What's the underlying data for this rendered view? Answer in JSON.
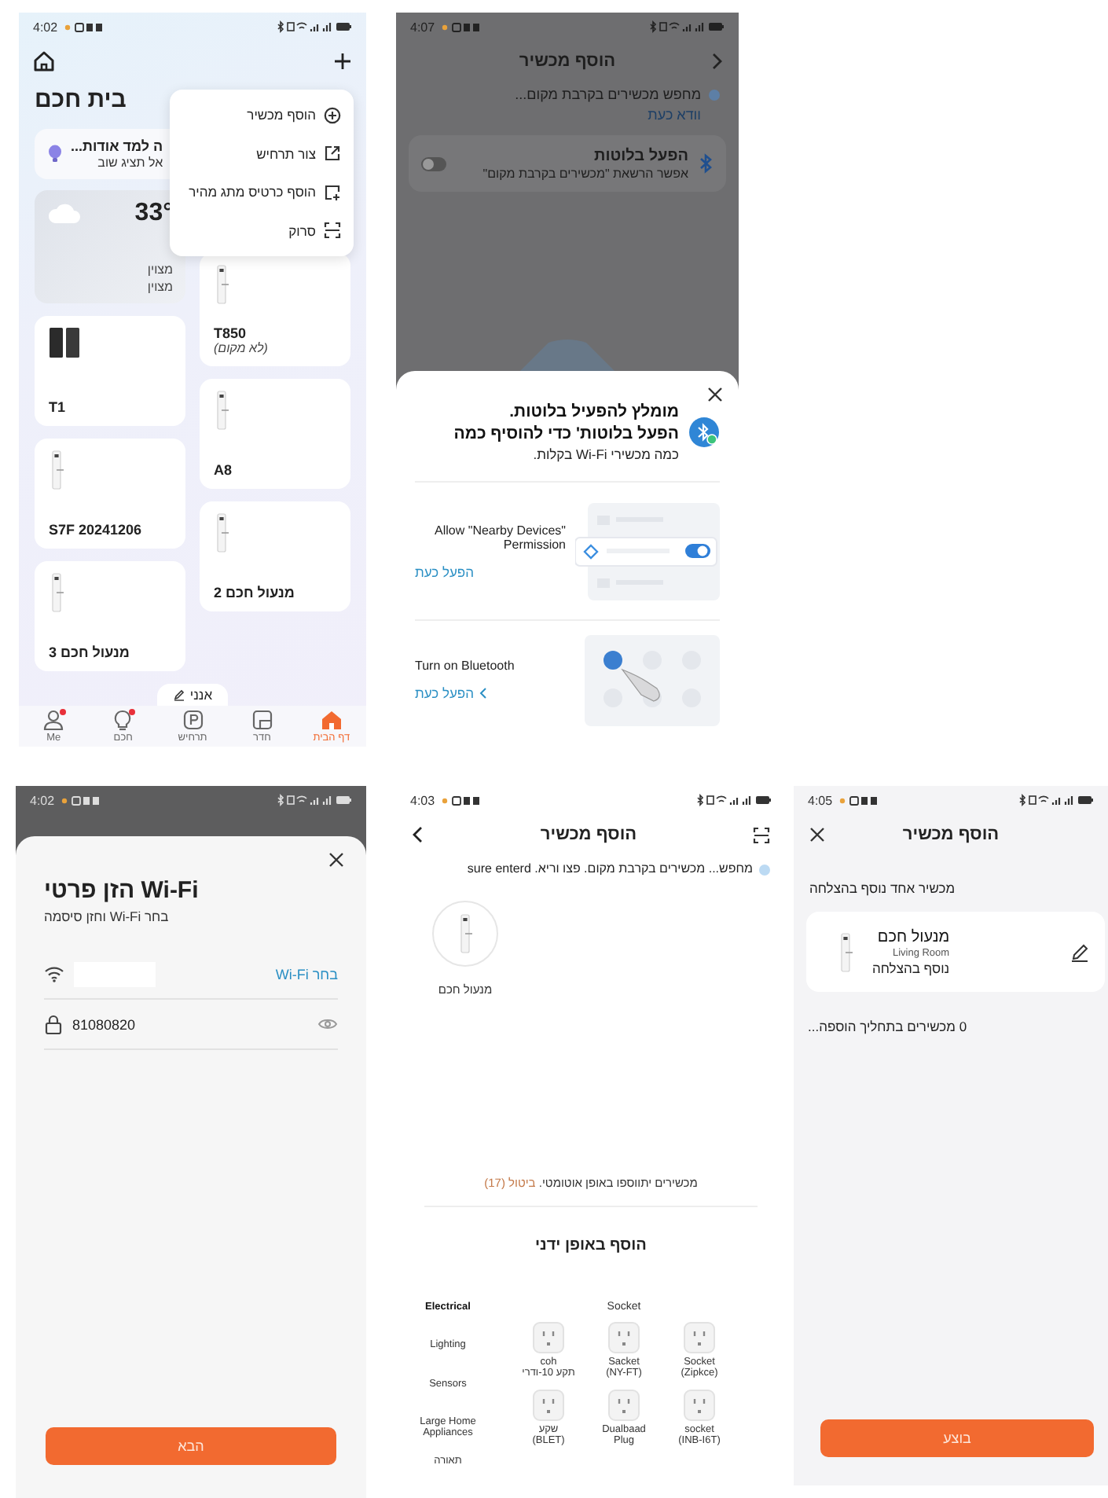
{
  "home_screen": {
    "status_time": "4:02",
    "title": "בית חכם",
    "tip": {
      "title": "ה למד אודות...",
      "subtitle": "אל תציג שוב"
    },
    "menu": [
      {
        "label": "הוסף מכשיר"
      },
      {
        "label": "צור תרחיש"
      },
      {
        "label": "הוסף כרטיס מתג מהיר"
      },
      {
        "label": "סרוק"
      }
    ],
    "columns": [
      {
        "cards": [
          {
            "kind": "weather",
            "temperature": "33°",
            "lines": [
              "מצוין",
              "מצוין"
            ]
          },
          {
            "kind": "keypad",
            "name": "T1"
          },
          {
            "kind": "lock",
            "name": "S7F 20241206"
          },
          {
            "kind": "lock",
            "name": "מנעול חכם 3"
          }
        ]
      },
      {
        "cards": [
          {
            "kind": "lock",
            "name": "T850",
            "note": "(לא מקום)"
          },
          {
            "kind": "lock",
            "name": "A8"
          },
          {
            "kind": "lock",
            "name": "מנעול חכם 2"
          }
        ]
      }
    ],
    "room_chip": "אנני",
    "nav": [
      {
        "label": "דף הבית",
        "badge": false,
        "selected": true
      },
      {
        "label": "חדר",
        "badge": false,
        "selected": false
      },
      {
        "label": "תרחיש",
        "badge": false,
        "selected": false
      },
      {
        "label": "חכם",
        "badge": true,
        "selected": false
      },
      {
        "label": "Me",
        "badge": true,
        "selected": false
      }
    ]
  },
  "bluetooth_screen": {
    "status_time": "4:07",
    "title": "הוסף מכשיר",
    "searching": "מחפש מכשירים בקרבת מקום...",
    "check_link": "וודא כעת",
    "bluetooth_card": {
      "title": "הפעל בלוטות",
      "subtitle": "אפשר הרשאת \"מכשירים בקרבת מקום\"",
      "on": false
    },
    "sheet": {
      "title_lines": [
        "מומלץ להפעיל בלוטות.",
        "הפעל בלוטות' כדי להוסיף כמה"
      ],
      "body": "כמה מכשירי Wi-Fi בקלות.",
      "steps": [
        {
          "kind": "permission",
          "text": "Allow \"Nearby Devices\" Permission",
          "link": "הפעל כעת"
        },
        {
          "kind": "bluetooth",
          "text": "Turn on Bluetooth",
          "link": "הפעל כעת"
        }
      ]
    }
  },
  "wifi_screen": {
    "status_time": "4:02",
    "title": "הזן פרטי Wi-Fi",
    "subtitle": "בחר Wi-Fi וחזן סיסמה",
    "choose_link": "בחר Wi-Fi",
    "password": "81080820",
    "next_button": "הבא"
  },
  "scan_screen": {
    "status_time": "4:03",
    "title": "הוסף מכשיר",
    "searching": "מחפש... מכשירים בקרבת מקום. פצו וריא. sure enterd",
    "found": [
      {
        "name": "מנעול חכם"
      }
    ],
    "auto_add": "מכשירים יתווספו באופן אוטומטי.",
    "cancel": "ביטול (17)",
    "manual_title": "הוסף באופן ידני",
    "categories": [
      {
        "label": "Electrical",
        "selected": true
      },
      {
        "label": "Lighting",
        "selected": false
      },
      {
        "label": "Sensors",
        "selected": false
      },
      {
        "label": "Large Home Appliances",
        "selected": false
      },
      {
        "label": "תאורה",
        "selected": false
      }
    ],
    "group_title": "Socket",
    "products": [
      {
        "lines": [
          "Socket",
          "(Zipkce)"
        ]
      },
      {
        "lines": [
          "Sacket",
          "(NY-FT)"
        ]
      },
      {
        "lines": [
          "coh",
          "תקע 10-ודרי"
        ]
      },
      {
        "lines": [
          "socket",
          "(INB-I6T)"
        ]
      },
      {
        "lines": [
          "Dualbaad",
          "Plug"
        ]
      },
      {
        "lines": [
          "שקע",
          "(BLET)"
        ]
      }
    ]
  },
  "done_screen": {
    "status_time": "4:05",
    "title": "הוסף מכשיר",
    "success_note": "מכשיר אחד נוסף בהצלחה",
    "device": {
      "name": "מנעול חכם",
      "room": "Living Room",
      "status": "נוסף בהצלחה"
    },
    "pending": "0 מכשירים בתחליך הוספה...",
    "done_button": "בוצע"
  }
}
